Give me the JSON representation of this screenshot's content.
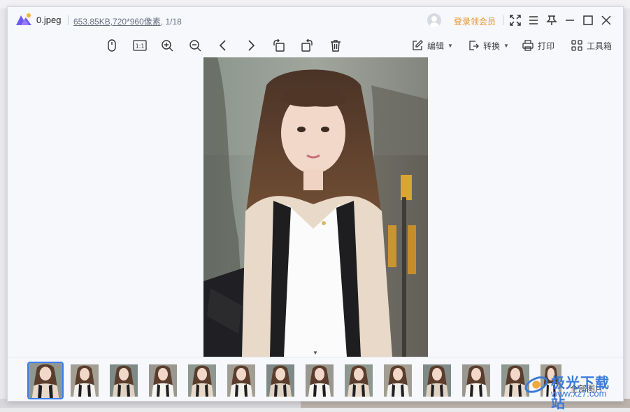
{
  "titlebar": {
    "filename": "0.jpeg",
    "file_size": "653.85KB",
    "dimensions": ",720*960像素",
    "position": ", 1/18",
    "login_label": "登录领会员",
    "accent_color": "#e8912c"
  },
  "icons": {
    "window": [
      "avatar-icon",
      "fullscreen-icon",
      "menu-icon",
      "pin-icon",
      "minimize-icon",
      "maximize-icon",
      "close-icon"
    ],
    "toolbar": [
      "mouse-icon",
      "actual-size-icon",
      "zoom-in-icon",
      "zoom-out-icon",
      "previous-icon",
      "next-icon",
      "rotate-left-icon",
      "rotate-right-icon",
      "delete-icon"
    ]
  },
  "toolbar": {
    "actual_size_label": "1:1",
    "edit_label": "编辑",
    "convert_label": "转换",
    "print_label": "打印",
    "toolbox_label": "工具箱"
  },
  "thumbnails": {
    "count_visible": 14,
    "selected_index": 0,
    "all_images_label": "全部图片",
    "selected_border_color": "#3a7df0"
  },
  "watermark": {
    "text": "极光下载站",
    "url": "www.xz7.com"
  }
}
